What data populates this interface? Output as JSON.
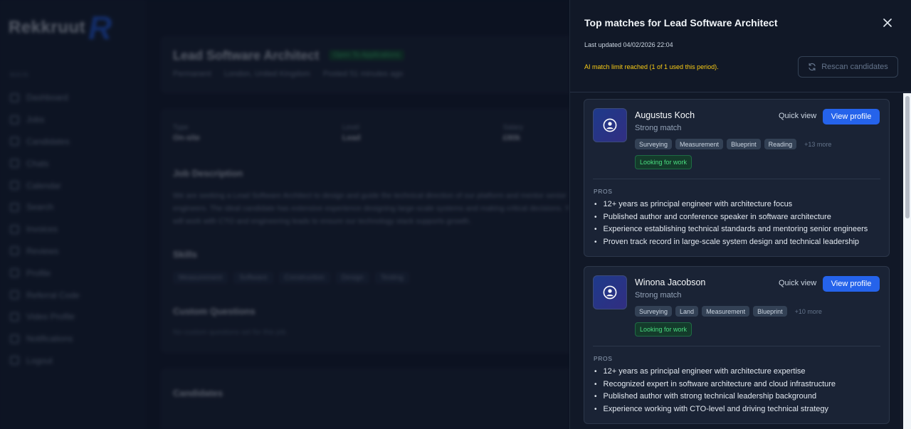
{
  "app": {
    "logo_text": "Rekkruut",
    "logo_mark": "R",
    "nav_section": "MAIN",
    "nav_items": [
      "Dashboard",
      "Jobs",
      "Candidates",
      "Chats",
      "Calendar",
      "Search",
      "Invoices",
      "Reviews",
      "Profile",
      "Referral Code",
      "Video Profile",
      "Notifications",
      "Logout"
    ]
  },
  "job": {
    "title": "Lead Software Architect",
    "badge": "Open To Applications",
    "work_mode": "Permanent",
    "location": "London, United Kingdom",
    "posted": "Posted 51 minutes ago",
    "info": [
      {
        "label": "Type",
        "value": "On-site"
      },
      {
        "label": "Level",
        "value": "Lead"
      },
      {
        "label": "Salary",
        "value": "£80k"
      }
    ],
    "description_heading": "Job Description",
    "description": "We are seeking a Lead Software Architect to design and guide the technical direction of our platform and mentor senior engineers. The ideal candidate has extensive experience designing large-scale systems and making critical decisions. You will work with CTO and engineering leads to ensure our technology stack supports growth.",
    "skills_heading": "Skills",
    "skills": [
      "Measurement",
      "Software",
      "Construction",
      "Design",
      "Testing"
    ],
    "questions_heading": "Custom Questions",
    "questions_empty": "No custom questions set for this job.",
    "candidates_heading": "Candidates"
  },
  "panel": {
    "title": "Top matches for Lead Software Architect",
    "last_updated": "Last updated 04/02/2026 22:04",
    "limit_note": "AI match limit reached (1 of 1 used this period).",
    "rescan_label": "Rescan candidates",
    "quick_view_label": "Quick view",
    "view_profile_label": "View profile",
    "pros_label": "PROS"
  },
  "candidates": [
    {
      "name": "Augustus Koch",
      "strength": "Strong match",
      "skills": [
        "Surveying",
        "Measurement",
        "Blueprint",
        "Reading"
      ],
      "more": "+13 more",
      "status": "Looking for work",
      "pros": [
        "12+ years as principal engineer with architecture focus",
        "Published author and conference speaker in software architecture",
        "Experience establishing technical standards and mentoring senior engineers",
        "Proven track record in large-scale system design and technical leadership"
      ]
    },
    {
      "name": "Winona Jacobson",
      "strength": "Strong match",
      "skills": [
        "Surveying",
        "Land",
        "Measurement",
        "Blueprint"
      ],
      "more": "+10 more",
      "status": "Looking for work",
      "pros": [
        "12+ years as principal engineer with architecture expertise",
        "Recognized expert in software architecture and cloud infrastructure",
        "Published author with strong technical leadership background",
        "Experience working with CTO-level and driving technical strategy"
      ]
    }
  ],
  "colors": {
    "accent": "#2563eb",
    "warning": "#facc15",
    "success": "#4ade80",
    "panel_bg": "#111827",
    "card_bg": "#1a2335"
  }
}
